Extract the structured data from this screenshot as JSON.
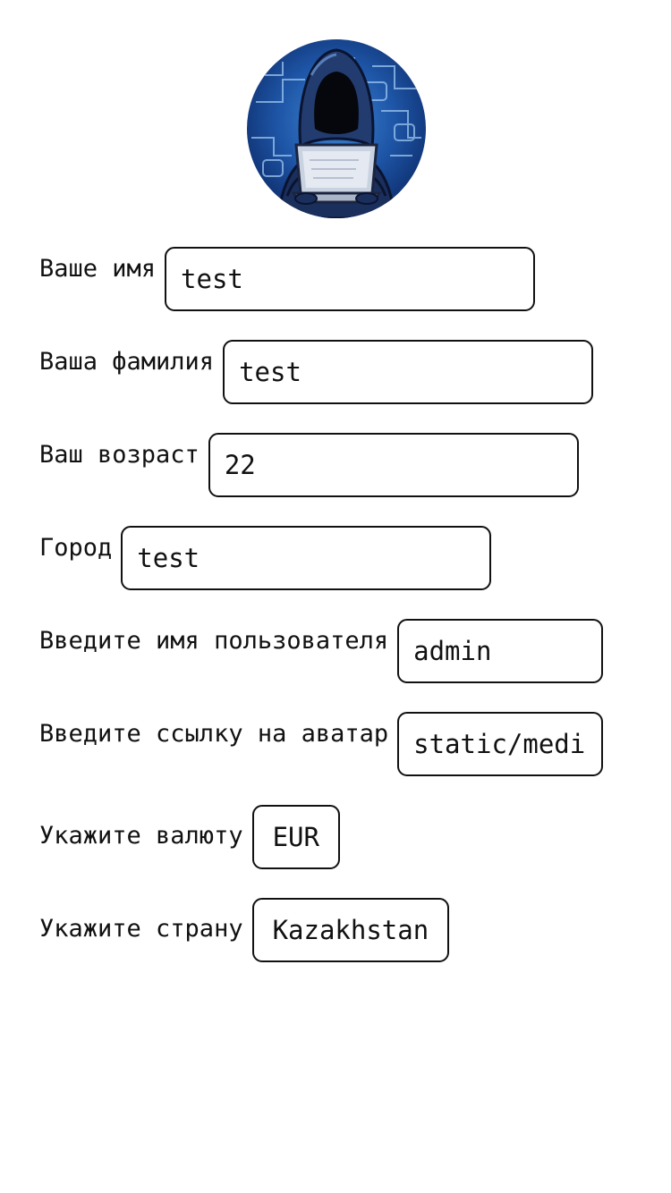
{
  "profile": {
    "avatar_icon": "hooded-hacker-laptop-avatar",
    "colors": {
      "avatar_bg": "#1f4f9a",
      "border": "#111111",
      "text": "#111111"
    }
  },
  "form": {
    "first_name": {
      "label": "Ваше имя",
      "value": "test"
    },
    "last_name": {
      "label": "Ваша фамилия",
      "value": "test"
    },
    "age": {
      "label": "Ваш возраст",
      "value": "22"
    },
    "city": {
      "label": "Город",
      "value": "test"
    },
    "username": {
      "label": "Введите имя пользователя",
      "value": "admin"
    },
    "avatar_link": {
      "label": "Введите ссылку на аватар",
      "value": "static/medi"
    },
    "currency": {
      "label": "Укажите валюту",
      "value": "EUR"
    },
    "country": {
      "label": "Укажите страну",
      "value": "Kazakhstan"
    }
  }
}
